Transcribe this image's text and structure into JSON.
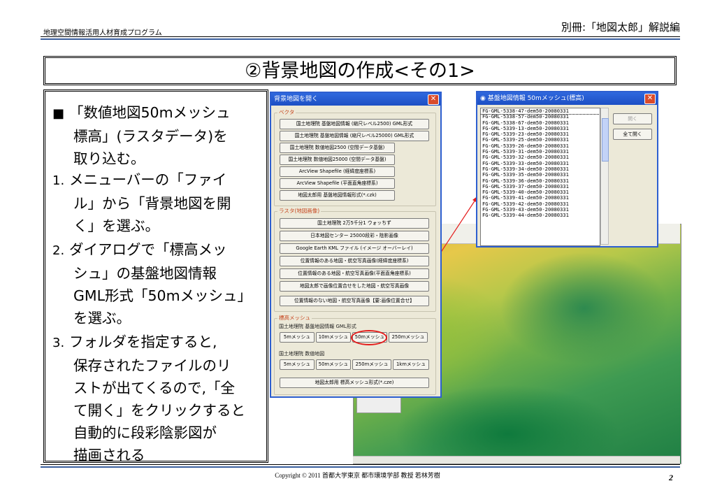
{
  "header": {
    "left": "地理空間情報活用人材育成プログラム",
    "right": "別冊:「地図太郎」解説編"
  },
  "title": "②背景地図の作成<その1>",
  "instructions": {
    "bullet": "■",
    "bullet_lines": [
      "「数値地図50mメッシュ",
      "標高」(ラスタデータ)を",
      "取り込む。"
    ],
    "steps": [
      {
        "num": "1.",
        "lines": [
          "メニューバーの「ファイ",
          "ル」から「背景地図を開",
          "く」を選ぶ。"
        ]
      },
      {
        "num": "2.",
        "lines": [
          "ダイアログで「標高メッ",
          "シュ」の基盤地図情報",
          "GML形式「50mメッシュ」",
          "を選ぶ。"
        ]
      },
      {
        "num": "3.",
        "lines": [
          "フォルダを指定すると,",
          "保存されたファイルのリ",
          "ストが出てくるので,「全",
          "て開く」をクリックすると",
          "自動的に段彩陰影図が",
          "描画される"
        ]
      }
    ]
  },
  "dialog_open": {
    "title": "背景地図を開く",
    "close": "✕",
    "vector_group": "ベクタ",
    "vector_buttons": [
      "国土地理院 基盤地図情報 (縮尺レベル2500) GML形式",
      "国土地理院 基盤地図情報 (縮尺レベル25000) GML形式",
      "国土地理院 数値地図2500 (空間データ基盤)",
      "国土地理院 数値地図25000 (空間データ基盤)",
      "ArcView Shapefile (経緯度座標系)",
      "ArcView Shapefile (平面直角座標系)",
      "地図太郎用 基盤地図情報形式(*.czk)"
    ],
    "raster_group": "ラスタ(地図画像)",
    "raster_buttons": [
      "国土地理院 2万5千分1 ウォッちず",
      "日本地図センター 25000段彩・陰影画像",
      "Google Earth KML ファイル (イメージ オーバーレイ)",
      "位置情報のある地図・航空写真画像(経緯度座標系)",
      "位置情報のある地図・航空写真画像(平面直角座標系)",
      "地図太郎で画像位置合せをした地図・航空写真画像",
      "位置情報のない地図・航空写真画像【要:画像位置合せ】"
    ],
    "elev_group": "標高メッシュ",
    "elev_sub1": "国土地理院 基盤地図情報 GML形式",
    "elev_buttons1": [
      "5mメッシュ",
      "10mメッシュ",
      "50mメッシュ",
      "250mメッシュ"
    ],
    "elev_sub2": "国土地理院 数値地図",
    "elev_buttons2": [
      "5mメッシュ",
      "50mメッシュ",
      "250mメッシュ",
      "1kmメッシュ"
    ],
    "elev_last": "地図太郎用 標高メッシュ形式(*.cze)"
  },
  "dialog_files": {
    "title": "基盤地図情報 50mメッシュ(標高)",
    "close": "✕",
    "open_button": "開く",
    "open_all_button": "全て開く",
    "files": [
      "FG-GML-5338-47-dem50-20080331",
      "FG-GML-5338-57-dem50-20080331",
      "FG-GML-5338-67-dem50-20080331",
      "FG-GML-5339-13-dem50-20080331",
      "FG-GML-5339-23-dem50-20080331",
      "FG-GML-5339-25-dem50-20080331",
      "FG-GML-5339-26-dem50-20080331",
      "FG-GML-5339-31-dem50-20080331",
      "FG-GML-5339-32-dem50-20080331",
      "FG-GML-5339-33-dem50-20080331",
      "FG-GML-5339-34-dem50-20080331",
      "FG-GML-5339-35-dem50-20080331",
      "FG-GML-5339-36-dem50-20080331",
      "FG-GML-5339-37-dem50-20080331",
      "FG-GML-5339-40-dem50-20080331",
      "FG-GML-5339-41-dem50-20080331",
      "FG-GML-5339-42-dem50-20080331",
      "FG-GML-5339-43-dem50-20080331",
      "FG-GML-5339-44-dem50-20080331"
    ]
  },
  "footer": {
    "copyright": "Copyright © 2011 首都大学東京 都市環境学部 教授 若林芳樹",
    "page": "2"
  },
  "colors": {
    "accent_blue": "#3a5f9e",
    "highlight_red": "#e41b1b",
    "group_label": "#c6461f"
  }
}
